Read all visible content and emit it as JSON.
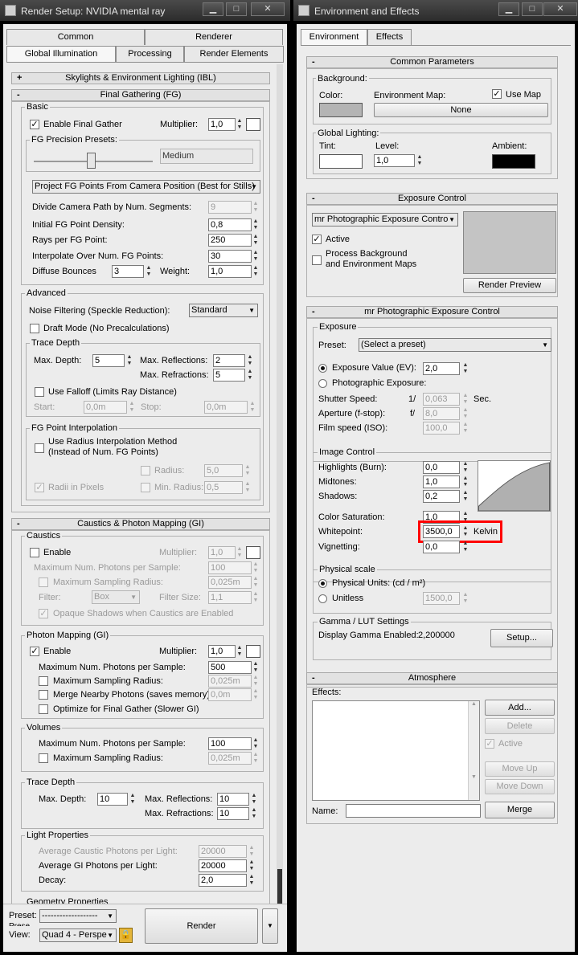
{
  "render_setup": {
    "title": "Render Setup: NVIDIA mental ray",
    "tabs": [
      "Common",
      "Renderer",
      "Global Illumination",
      "Processing",
      "Render Elements"
    ],
    "ibl_rollout": "Skylights & Environment Lighting (IBL)",
    "fg_rollout": "Final Gathering (FG)",
    "basic": {
      "group": "Basic",
      "enable_final_gather": "Enable Final Gather",
      "multiplier_label": "Multiplier:",
      "multiplier": "1,0",
      "presets_group": "FG Precision Presets:",
      "preset_value": "Medium"
    },
    "project_mode": "Project FG Points From Camera Position (Best for Stills)",
    "divide_label": "Divide Camera Path by Num. Segments:",
    "divide_value": "9",
    "density_label": "Initial FG Point Density:",
    "density_value": "0,8",
    "rays_label": "Rays per FG Point:",
    "rays_value": "250",
    "interp_label": "Interpolate Over Num. FG Points:",
    "interp_value": "30",
    "bounces_label": "Diffuse Bounces",
    "bounces_value": "3",
    "weight_label": "Weight:",
    "weight_value": "1,0",
    "advanced": {
      "group": "Advanced",
      "noise_label": "Noise Filtering (Speckle Reduction):",
      "noise_value": "Standard",
      "draft_mode": "Draft Mode (No Precalculations)"
    },
    "trace_depth": {
      "group": "Trace Depth",
      "max_depth_label": "Max. Depth:",
      "max_depth": "5",
      "max_refl_label": "Max. Reflections:",
      "max_refl": "2",
      "max_refr_label": "Max. Refractions:",
      "max_refr": "5",
      "use_falloff": "Use Falloff (Limits Ray Distance)",
      "start_label": "Start:",
      "start": "0,0m",
      "stop_label": "Stop:",
      "stop": "0,0m"
    },
    "fg_interp": {
      "group": "FG Point Interpolation",
      "use_radius_1": "Use Radius Interpolation Method",
      "use_radius_2": "(Instead of Num. FG Points)",
      "radius_label": "Radius:",
      "radius": "5,0",
      "radii_pixels": "Radii in Pixels",
      "min_radius_label": "Min. Radius:",
      "min_radius": "0,5"
    },
    "caustics_rollout": "Caustics & Photon Mapping (GI)",
    "caustics": {
      "group": "Caustics",
      "enable": "Enable",
      "multiplier_label": "Multiplier:",
      "multiplier": "1,0",
      "max_photons_label": "Maximum Num. Photons per Sample:",
      "max_photons": "100",
      "max_sampling_label": "Maximum Sampling Radius:",
      "max_sampling": "0,025m",
      "filter_label": "Filter:",
      "filter_value": "Box",
      "filter_size_label": "Filter Size:",
      "filter_size": "1,1",
      "opaque": "Opaque Shadows when Caustics are Enabled"
    },
    "photon": {
      "group": "Photon Mapping (GI)",
      "enable": "Enable",
      "multiplier_label": "Multiplier:",
      "multiplier": "1,0",
      "max_photons_label": "Maximum Num. Photons per Sample:",
      "max_photons": "500",
      "max_sampling_label": "Maximum Sampling Radius:",
      "max_sampling": "0,025m",
      "merge_label": "Merge Nearby Photons (saves memory):",
      "merge": "0,0m",
      "optimize": "Optimize for Final Gather (Slower GI)"
    },
    "volumes": {
      "group": "Volumes",
      "max_photons_label": "Maximum Num. Photons per Sample:",
      "max_photons": "100",
      "max_sampling_label": "Maximum Sampling Radius:",
      "max_sampling": "0,025m"
    },
    "trace_depth2": {
      "group": "Trace Depth",
      "max_depth_label": "Max. Depth:",
      "max_depth": "10",
      "max_refl_label": "Max. Reflections:",
      "max_refl": "10",
      "max_refr_label": "Max. Refractions:",
      "max_refr": "10"
    },
    "light_props": {
      "group": "Light Properties",
      "avg_caustic_label": "Average Caustic Photons per Light:",
      "avg_caustic": "20000",
      "avg_gi_label": "Average GI Photons per Light:",
      "avg_gi": "20000",
      "decay_label": "Decay:",
      "decay": "2,0"
    },
    "geometry_group": "Geometry Properties",
    "bottom": {
      "preset_label": "Preset:",
      "preset_value": "-------------------",
      "view_overlap": "Prese",
      "view_label": "View:",
      "view_value": "Quad 4 - Perspe",
      "render": "Render"
    }
  },
  "env_effects": {
    "title": "Environment and Effects",
    "tabs": [
      "Environment",
      "Effects"
    ],
    "common": {
      "rollout": "Common Parameters",
      "background_group": "Background:",
      "color_label": "Color:",
      "env_map_label": "Environment Map:",
      "use_map": "Use Map",
      "map_button": "None",
      "global_group": "Global Lighting:",
      "tint_label": "Tint:",
      "level_label": "Level:",
      "level": "1,0",
      "ambient_label": "Ambient:"
    },
    "exposure": {
      "rollout": "Exposure Control",
      "type": "mr Photographic Exposure Contro",
      "active": "Active",
      "process_bg_1": "Process Background",
      "process_bg_2": "and Environment Maps",
      "render_preview": "Render Preview"
    },
    "mr_photo": {
      "rollout": "mr Photographic Exposure Control",
      "exposure_group": "Exposure",
      "preset_label": "Preset:",
      "preset_value": "(Select a preset)",
      "ev_label": "Exposure Value (EV):",
      "ev": "2,0",
      "photo_label": "Photographic Exposure:",
      "shutter_label": "Shutter Speed:",
      "shutter_prefix": "1/",
      "shutter": "0,063",
      "shutter_unit": "Sec.",
      "aperture_label": "Aperture (f-stop):",
      "aperture_prefix": "f/",
      "aperture": "8,0",
      "film_label": "Film speed (ISO):",
      "film": "100,0"
    },
    "image_control": {
      "group": "Image Control",
      "highlights_label": "Highlights (Burn):",
      "highlights": "0,0",
      "midtones_label": "Midtones:",
      "midtones": "1,0",
      "shadows_label": "Shadows:",
      "shadows": "0,2",
      "saturation_label": "Color Saturation:",
      "saturation": "1,0",
      "whitepoint_label": "Whitepoint:",
      "whitepoint": "3500,0",
      "kelvin": "Kelvin",
      "vignetting_label": "Vignetting:",
      "vignetting": "0,0"
    },
    "physical": {
      "group": "Physical scale",
      "physical_units": "Physical Units: (cd / m²)",
      "unitless": "Unitless",
      "unitless_value": "1500,0"
    },
    "gamma": {
      "group": "Gamma / LUT Settings",
      "display_label": "Display Gamma Enabled:",
      "display_value": "2,200000",
      "setup": "Setup..."
    },
    "atmosphere": {
      "rollout": "Atmosphere",
      "effects_label": "Effects:",
      "add": "Add...",
      "delete": "Delete",
      "active": "Active",
      "move_up": "Move Up",
      "move_down": "Move Down",
      "name_label": "Name:",
      "merge": "Merge"
    }
  },
  "colors": {
    "background_swatch": "#b4b4b4",
    "tint_swatch": "#ffffff",
    "ambient_swatch": "#000000",
    "highlight_box": "#ff0000",
    "curve_fill": "#b0b0b0"
  }
}
